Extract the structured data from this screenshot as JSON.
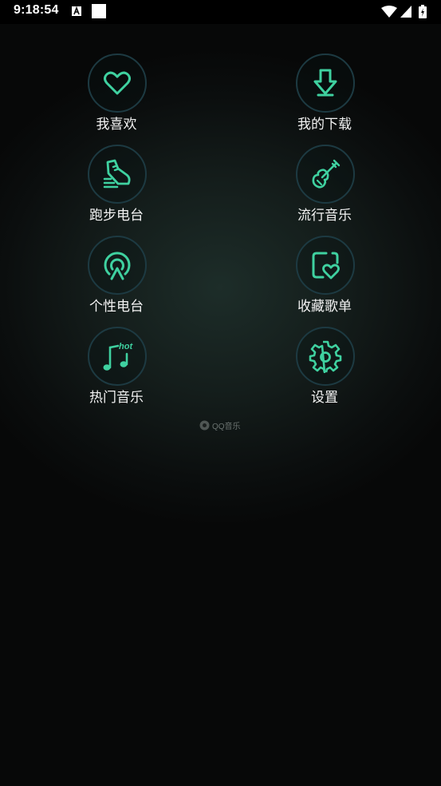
{
  "status_bar": {
    "time": "9:18:54"
  },
  "menu": {
    "items": [
      {
        "label": "我喜欢",
        "icon": "heart-icon"
      },
      {
        "label": "我的下载",
        "icon": "download-icon"
      },
      {
        "label": "跑步电台",
        "icon": "running-shoe-icon"
      },
      {
        "label": "流行音乐",
        "icon": "guitar-icon"
      },
      {
        "label": "个性电台",
        "icon": "radio-broadcast-icon"
      },
      {
        "label": "收藏歌单",
        "icon": "favorite-playlist-icon"
      },
      {
        "label": "热门音乐",
        "icon": "hot-music-icon"
      },
      {
        "label": "设置",
        "icon": "gear-icon"
      }
    ]
  },
  "footer": {
    "logo_text": "QQ音乐"
  },
  "colors": {
    "accent": "#3fd1a0",
    "circle_border": "#1d3a42",
    "background": "#101716"
  }
}
